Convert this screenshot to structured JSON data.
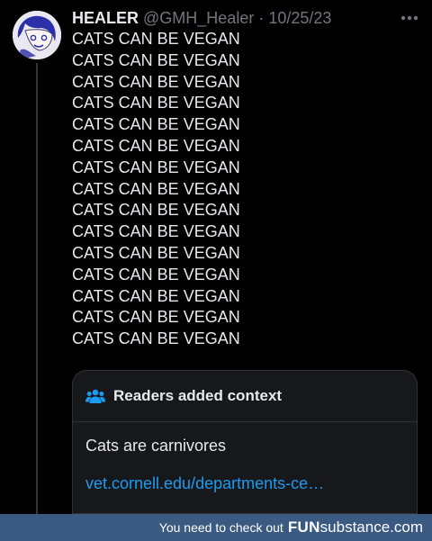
{
  "tweet": {
    "author": {
      "display_name": "HEALER",
      "handle": "@GMH_Healer",
      "avatar_icon": "anime-avatar-icon"
    },
    "separator": "·",
    "date": "10/25/23",
    "more_icon": "more-options-icon",
    "lines": [
      "CATS CAN BE VEGAN",
      "CATS CAN BE VEGAN",
      "CATS CAN BE VEGAN",
      "CATS CAN BE VEGAN",
      "CATS CAN BE VEGAN",
      "CATS CAN BE VEGAN",
      "CATS CAN BE VEGAN",
      "CATS CAN BE VEGAN",
      "CATS CAN BE VEGAN",
      "CATS CAN BE VEGAN",
      "CATS CAN BE VEGAN",
      "CATS CAN BE VEGAN",
      "CATS CAN BE VEGAN",
      "CATS CAN BE VEGAN",
      "CATS CAN BE VEGAN"
    ]
  },
  "community_note": {
    "icon": "people-icon",
    "title": "Readers added context",
    "text": "Cats are carnivores",
    "link_text": "vet.cornell.edu/departments-ce…"
  },
  "watermark": {
    "prefix": "You need to check out",
    "brand_bold": "FUN",
    "brand_rest": "substance.com"
  },
  "colors": {
    "background": "#000000",
    "text_primary": "#e7e9ea",
    "text_secondary": "#71767b",
    "link": "#1d9bf0",
    "note_icon": "#1d9bf0",
    "card_background": "#16181c",
    "watermark_bar": "#3b5a82"
  }
}
